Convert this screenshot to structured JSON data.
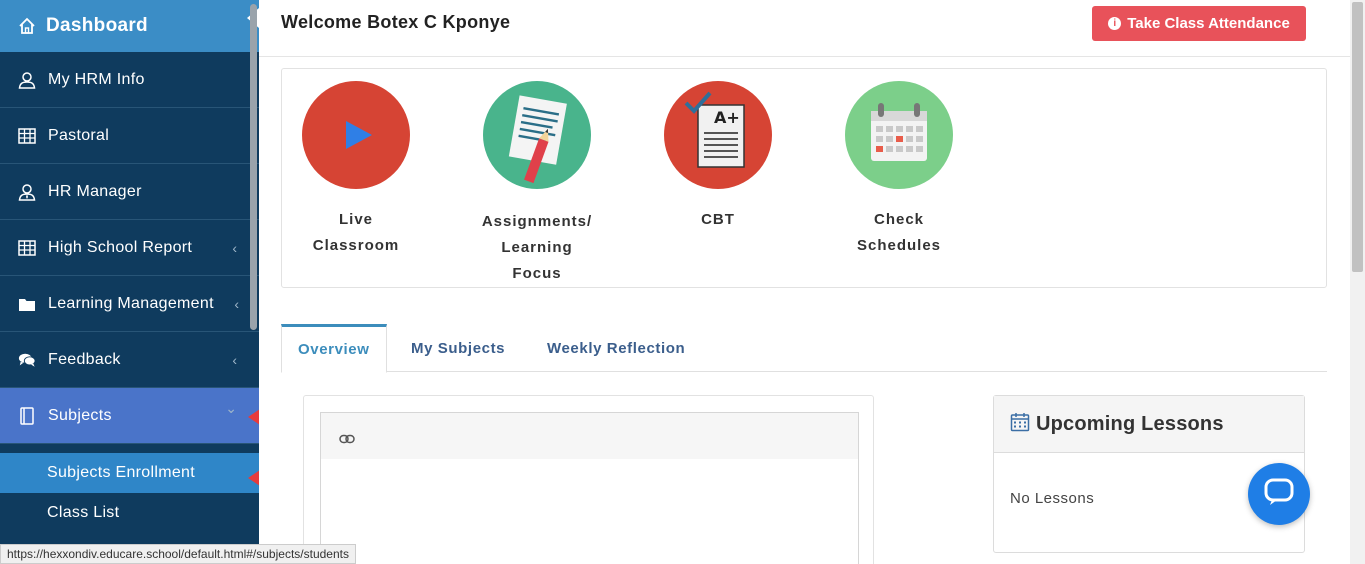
{
  "sidebar": {
    "header": {
      "label": "Dashboard",
      "icon": "home-icon"
    },
    "items": [
      {
        "label": "My HRM Info",
        "icon": "user-icon"
      },
      {
        "label": "Pastoral",
        "icon": "table-icon"
      },
      {
        "label": "HR Manager",
        "icon": "user-tie-icon"
      },
      {
        "label": "High School Report",
        "icon": "table-icon",
        "chevron": "‹"
      },
      {
        "label": "Learning Management",
        "icon": "folder-icon",
        "chevron": "‹"
      },
      {
        "label": "Feedback",
        "icon": "comments-icon",
        "chevron": "‹"
      },
      {
        "label": "Subjects",
        "icon": "book-icon",
        "chevron": "⌄"
      }
    ],
    "subitems": [
      {
        "label": "Subjects Enrollment"
      },
      {
        "label": "Class List"
      }
    ]
  },
  "header": {
    "welcome": "Welcome Botex C Kponye",
    "attendance_button": "Take Class Attendance"
  },
  "quick_links": [
    {
      "line1": "Live",
      "line2": "Classroom",
      "line3": "",
      "color": "#d64434"
    },
    {
      "line1": "Assignments/",
      "line2": "Learning",
      "line3": "Focus",
      "color": "#49b48c"
    },
    {
      "line1": "CBT",
      "line2": "",
      "line3": "",
      "color": "#d64434"
    },
    {
      "line1": "Check",
      "line2": "Schedules",
      "line3": "",
      "color": "#7ccf8a"
    }
  ],
  "tabs": [
    {
      "label": "Overview",
      "active": true
    },
    {
      "label": "My Subjects",
      "active": false
    },
    {
      "label": "Weekly Reflection",
      "active": false
    }
  ],
  "lessons": {
    "title": "Upcoming Lessons",
    "empty_text": "No Lessons"
  },
  "status_bar": {
    "url": "https://hexxondiv.educare.school/default.html#/subjects/students"
  },
  "colors": {
    "sidebar_bg": "#0f3b5e",
    "sidebar_header": "#3b8dc6",
    "active_item": "#4a74c9",
    "selected_subitem": "#2f86c8",
    "attendance_button": "#e8525a",
    "chat_button": "#1f7ee6"
  }
}
